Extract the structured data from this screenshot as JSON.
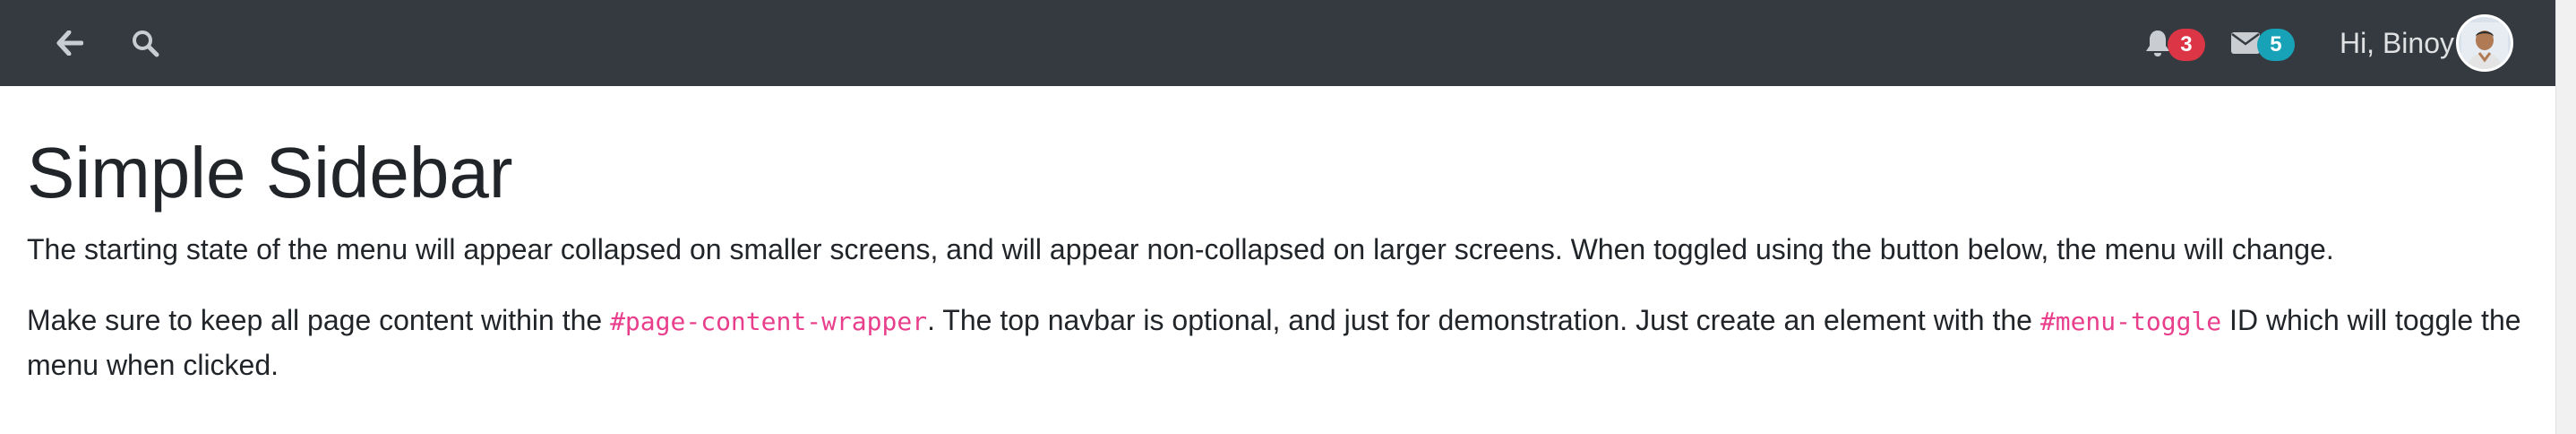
{
  "navbar": {
    "back_icon": "arrow-left-icon",
    "search_icon": "search-icon",
    "notifications": {
      "icon": "bell-icon",
      "count": "3",
      "color": "#dc3545"
    },
    "messages": {
      "icon": "envelope-icon",
      "count": "5",
      "color": "#17a2b8"
    },
    "greeting": "Hi, Binoy",
    "avatar": "user-avatar"
  },
  "main": {
    "title": "Simple Sidebar",
    "paragraph1": "The starting state of the menu will appear collapsed on smaller screens, and will appear non-collapsed on larger screens. When toggled using the button below, the menu will change.",
    "paragraph2": {
      "text1": "Make sure to keep all page content within the ",
      "code1": "#page-content-wrapper",
      "text2": ". The top navbar is optional, and just for demonstration. Just create an element with the ",
      "code2": "#menu-toggle",
      "text3": " ID which will toggle the menu when clicked."
    }
  },
  "colors": {
    "navbar_bg": "#343a40",
    "code_pink": "#e83e8c",
    "text": "#212529"
  }
}
